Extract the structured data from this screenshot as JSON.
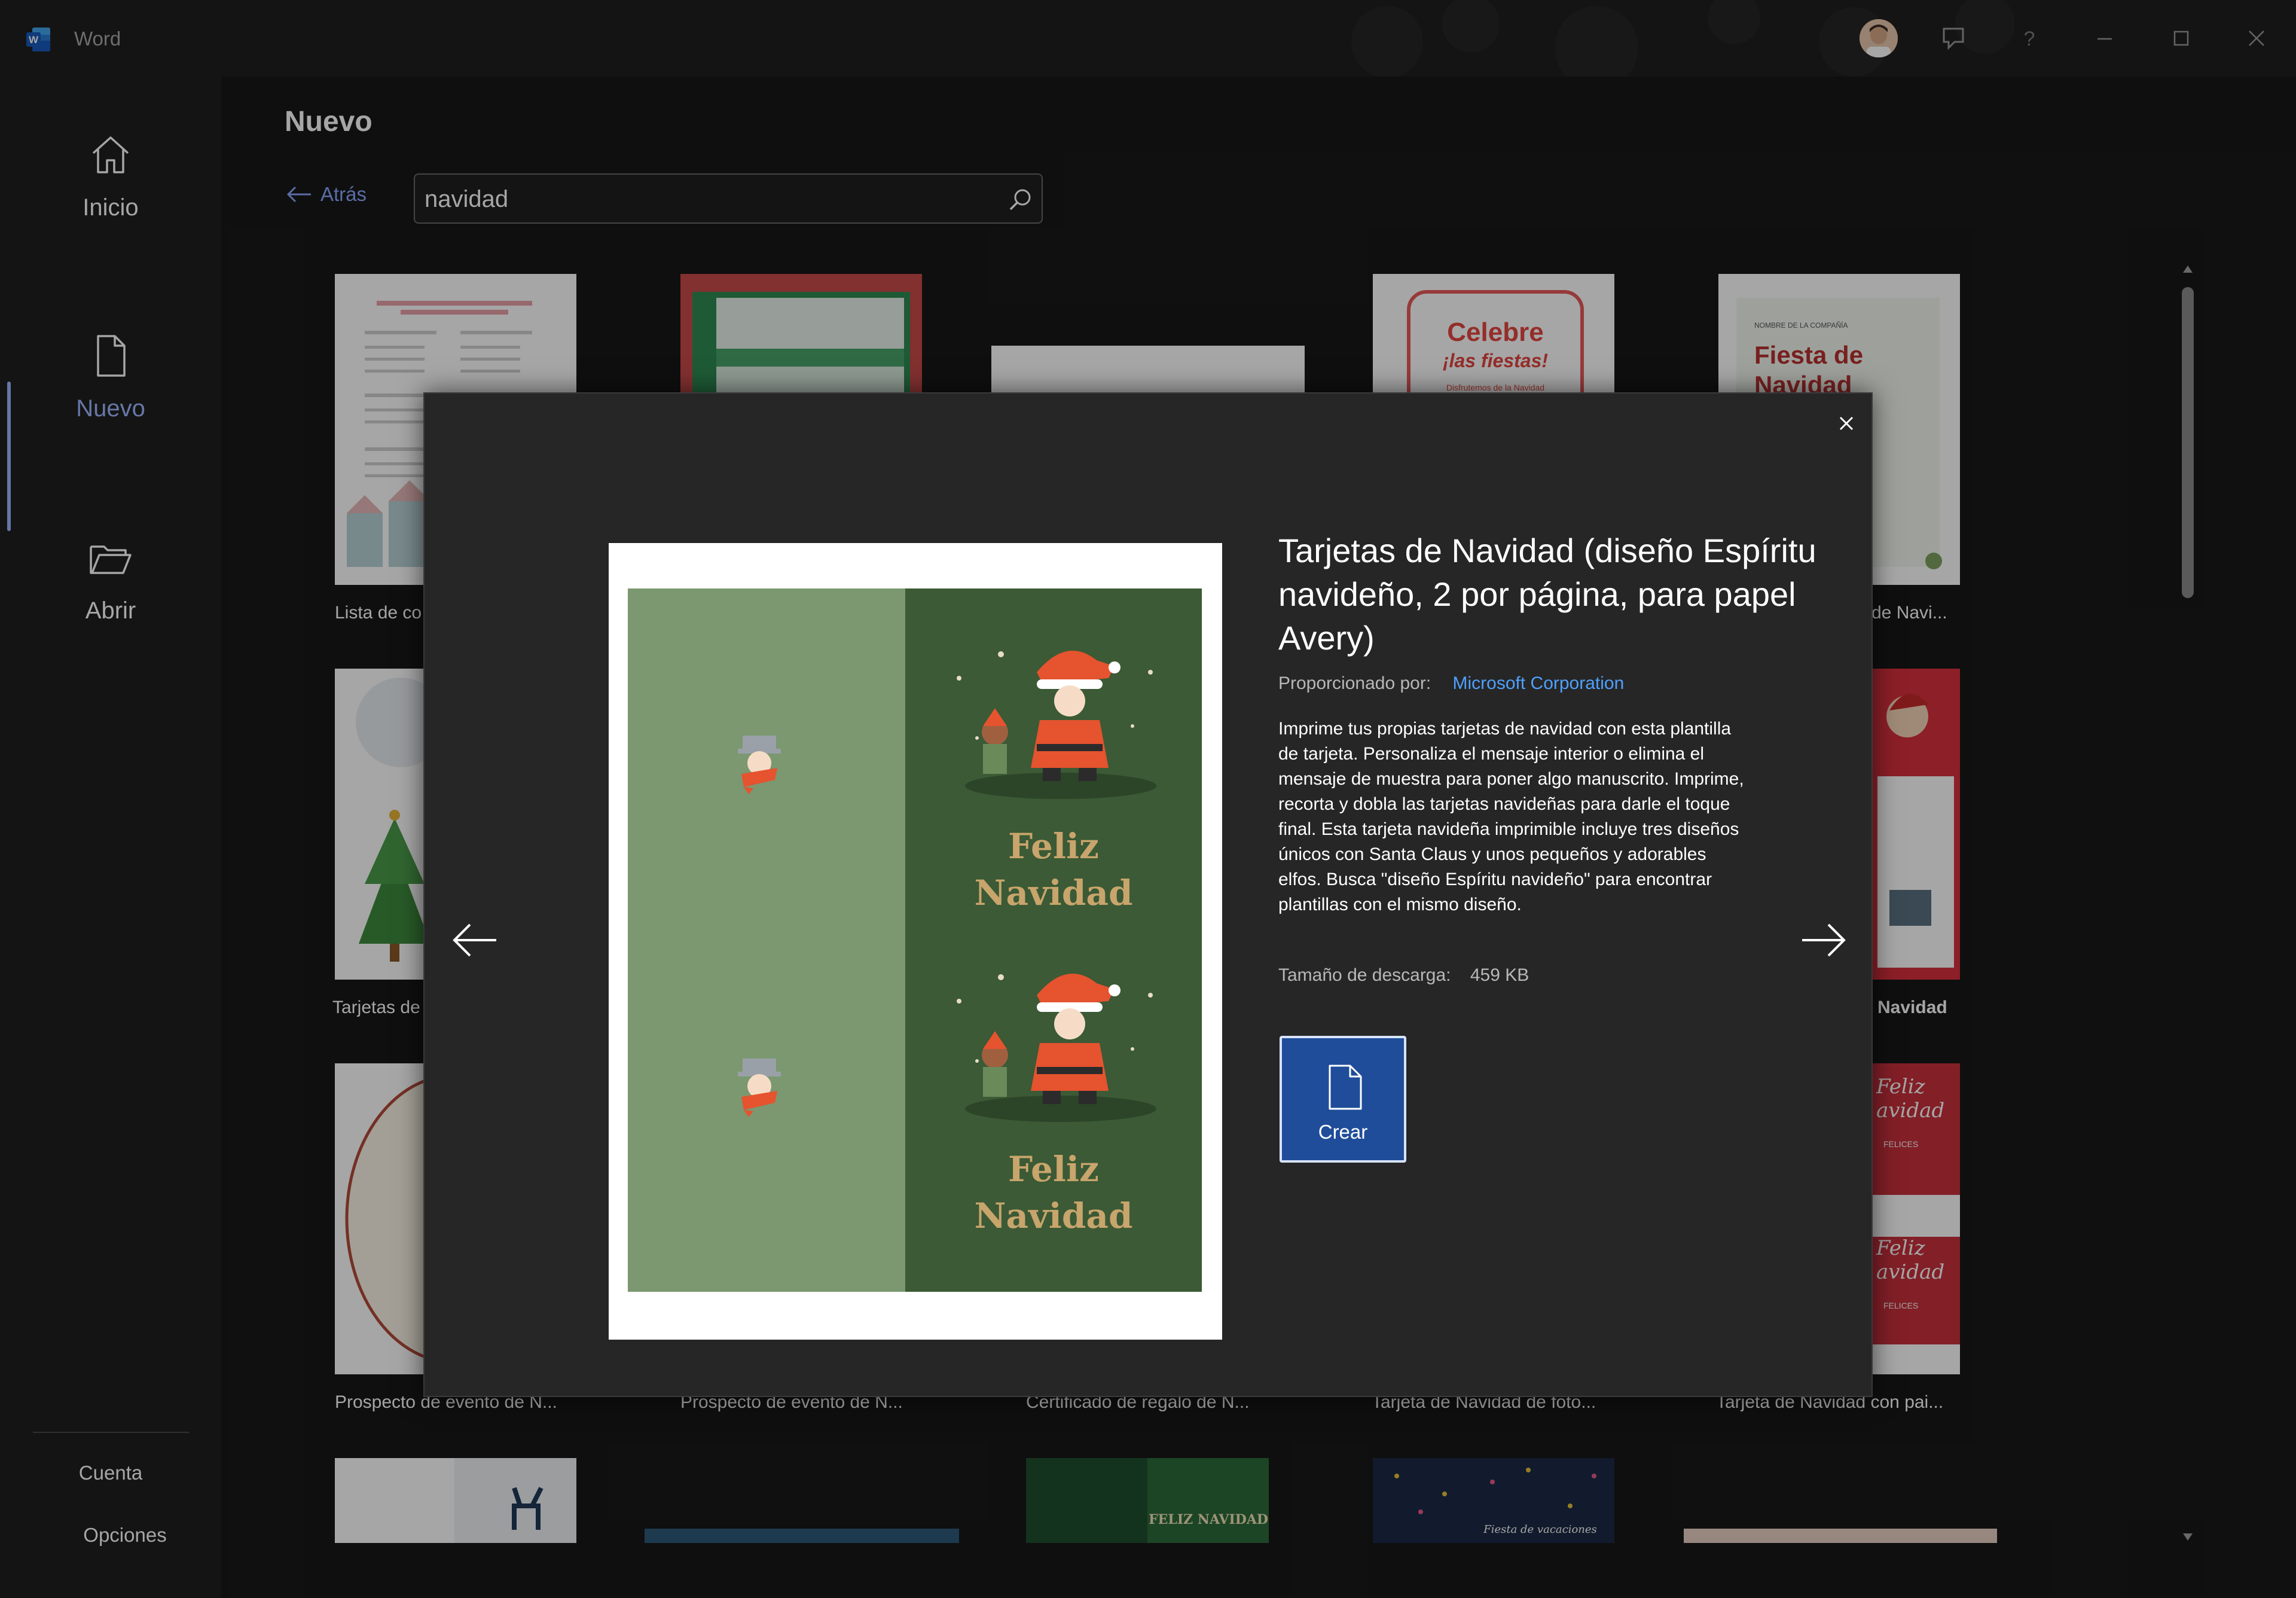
{
  "app": {
    "title": "Word"
  },
  "titlebar": {
    "icons": [
      "avatar",
      "feedback-icon",
      "help-icon",
      "minimize-icon",
      "maximize-icon",
      "close-icon"
    ]
  },
  "leftnav": {
    "items": [
      {
        "label": "Inicio",
        "icon": "home-icon"
      },
      {
        "label": "Nuevo",
        "icon": "new-document-icon",
        "selected": true
      },
      {
        "label": "Abrir",
        "icon": "folder-icon"
      }
    ],
    "bottom": [
      {
        "label": "Cuenta"
      },
      {
        "label": "Opciones"
      }
    ]
  },
  "main": {
    "heading": "Nuevo",
    "back_label": "Atrás",
    "search": {
      "value": "navidad",
      "placeholder": ""
    },
    "grid": {
      "row1_labels": [
        "Lista de co",
        "de Navi..."
      ],
      "row2_labels": [
        "Tarjetas de",
        "Navidad"
      ],
      "row3_labels": [
        "Prospecto de evento de N...",
        "Prospecto de evento de N...",
        "Certificado de regalo de N...",
        "Tarjeta de Navidad de foto...",
        "Tarjeta de Navidad con pai..."
      ]
    },
    "thumb_texts": {
      "celebre": "Celebre",
      "fiestas": "¡las fiestas!",
      "disfrutemos": "Disfrutemos de la Navidad",
      "compania": "NOMBRE DE LA COMPAÑÍA",
      "fiesta_de": "Fiesta de",
      "navidad": "Navidad",
      "feliz_script": "Feliz",
      "avidad_script": "avidad",
      "felices": "FELICES",
      "feliz_navidad_small": "FELIZ NAVIDAD",
      "fiesta_vacaciones": "Fiesta de vacaciones"
    }
  },
  "modal": {
    "title": "Tarjetas de Navidad (diseño Espíritu navideño, 2 por página, para papel Avery)",
    "provider_label": "Proporcionado por:",
    "provider_name": "Microsoft Corporation",
    "description": "Imprime tus propias tarjetas de navidad con esta plantilla de tarjeta. Personaliza el mensaje interior o elimina el mensaje de muestra para poner algo manuscrito. Imprime, recorta y dobla las tarjetas navideñas para darle el toque final. Esta tarjeta navideña imprimible incluye tres diseños únicos con Santa Claus y unos pequeños y adorables elfos. Busca \"diseño Espíritu navideño\" para encontrar plantillas con el mismo diseño.",
    "download_label": "Tamaño de descarga:",
    "download_size": "459 KB",
    "create_label": "Crear",
    "preview_text": {
      "line1": "Feliz",
      "line2": "Navidad"
    }
  },
  "colors": {
    "accent": "#9fb7ff",
    "link": "#4fa0ff",
    "create_button": "#1f4d9a",
    "card_light_green": "#7b9870",
    "card_dark_green": "#3b5a35",
    "card_gold": "#c8a56c"
  }
}
